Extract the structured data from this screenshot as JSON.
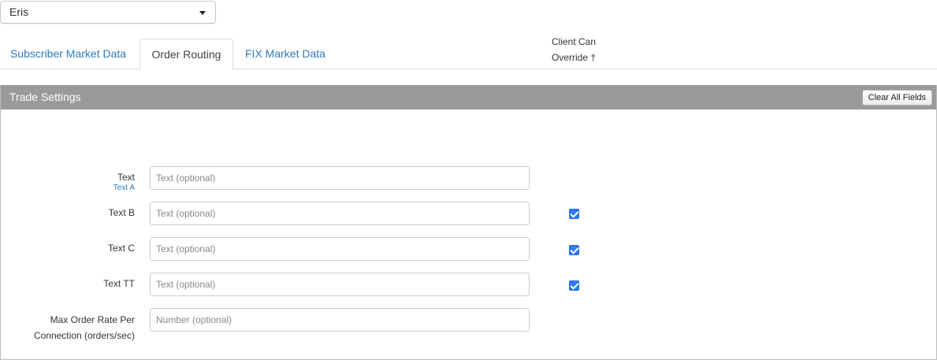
{
  "venue_select": {
    "selected": "Eris"
  },
  "tabs": [
    {
      "label": "Subscriber Market Data",
      "active": false
    },
    {
      "label": "Order Routing",
      "active": true
    },
    {
      "label": "FIX Market Data",
      "active": false
    }
  ],
  "panel": {
    "title": "Trade Settings",
    "clear_button": "Clear All Fields",
    "override_header": [
      "Client Can",
      "Override †"
    ]
  },
  "fields": [
    {
      "label": "Text",
      "sublabel": "Text A",
      "placeholder": "Text (optional)",
      "value": "",
      "override_checked": null
    },
    {
      "label": "Text B",
      "placeholder": "Text (optional)",
      "value": "",
      "override_checked": true
    },
    {
      "label": "Text C",
      "placeholder": "Text (optional)",
      "value": "",
      "override_checked": true
    },
    {
      "label": "Text TT",
      "placeholder": "Text (optional)",
      "value": "",
      "override_checked": true
    },
    {
      "label_lines": [
        "Max Order Rate Per",
        "Connection (orders/sec)"
      ],
      "placeholder": "Number (optional)",
      "value": "",
      "override_checked": null
    }
  ],
  "colors": {
    "link": "#2d7ab8",
    "panel_header": "#9a9a9a",
    "checkbox": "#2d7cf6"
  }
}
